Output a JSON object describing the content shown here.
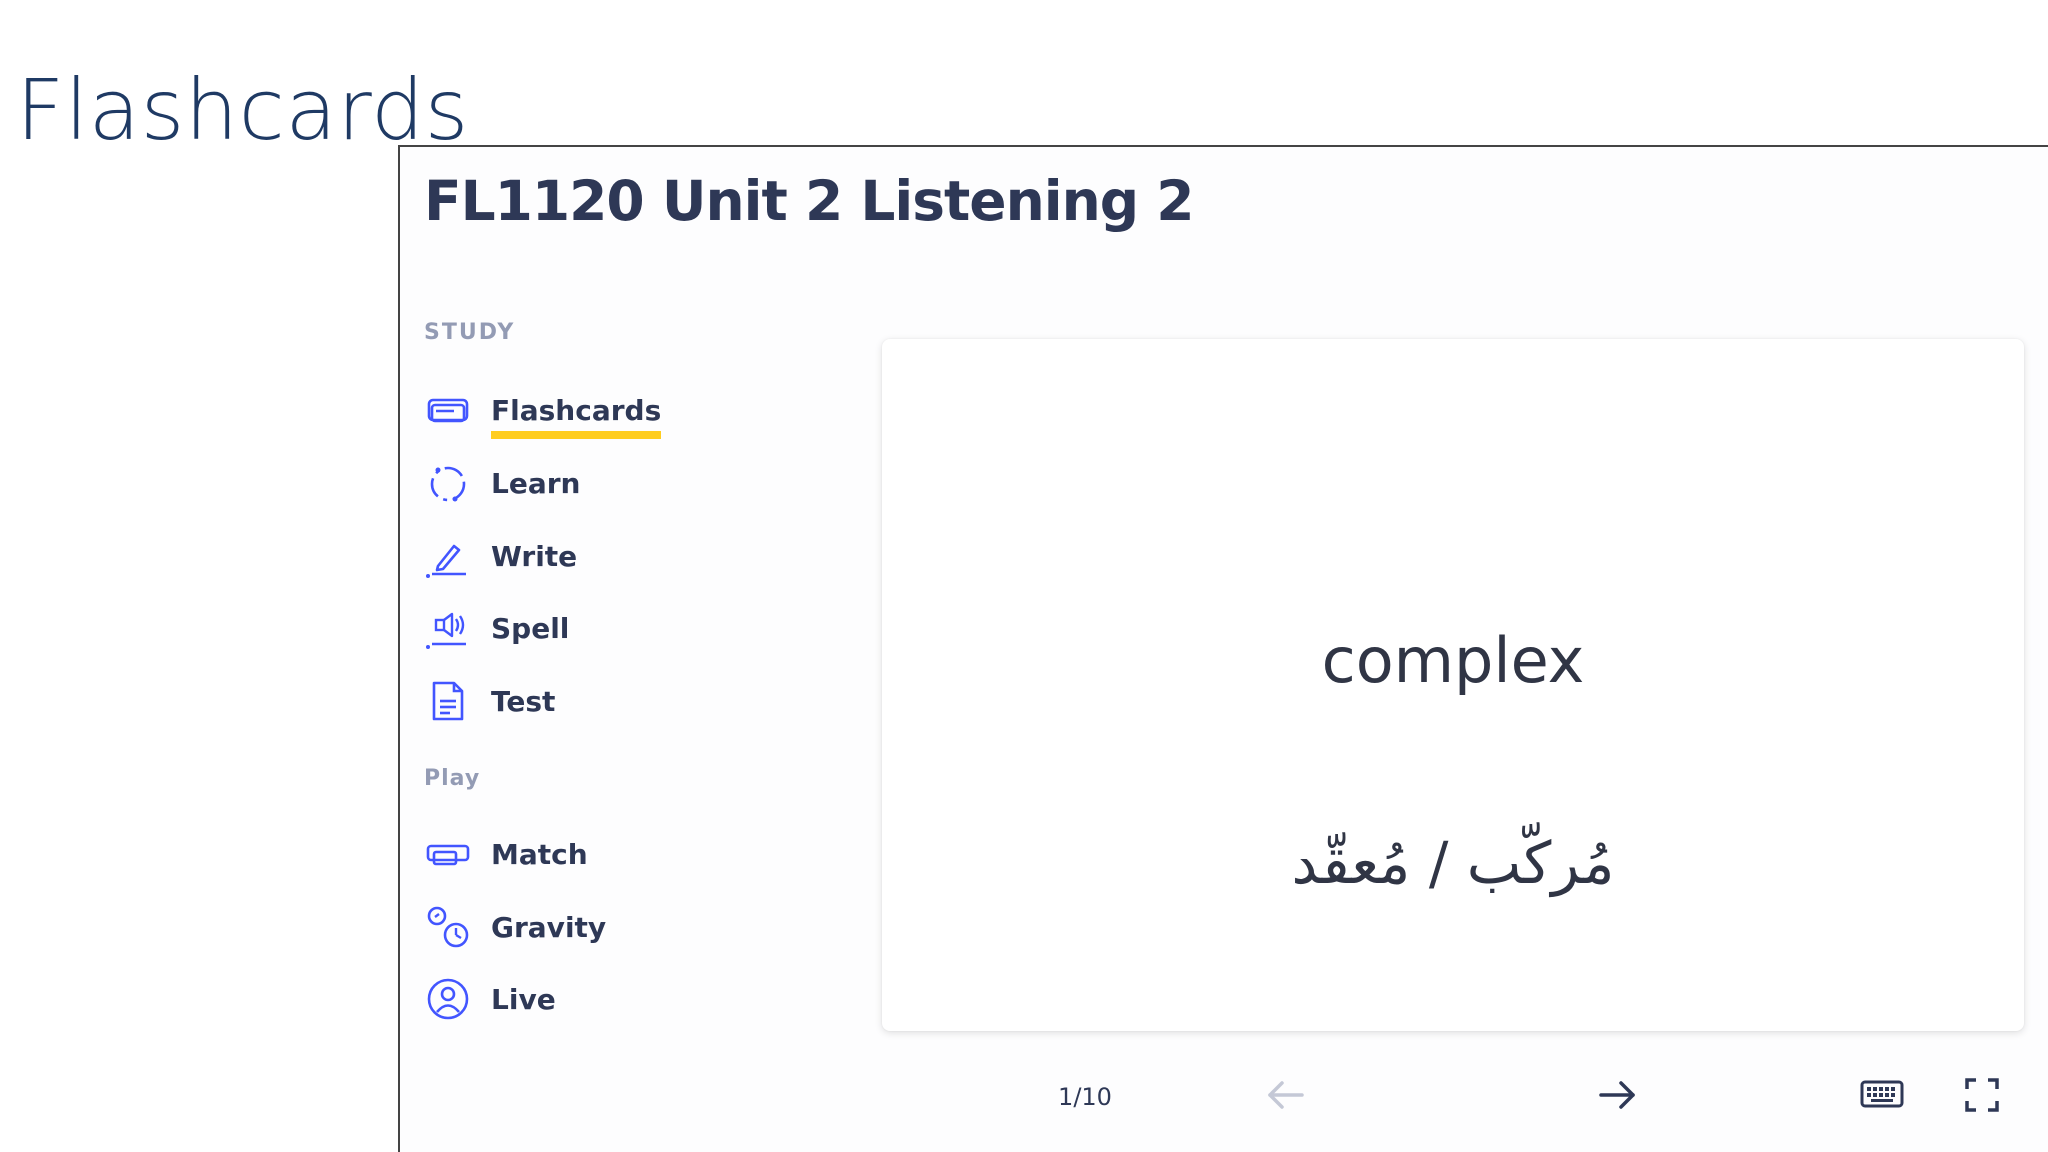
{
  "slide": {
    "title": "Flashcards"
  },
  "set": {
    "title": "FL1120 Unit 2 Listening 2"
  },
  "sidebar": {
    "study_label": "STUDY",
    "study_items": [
      {
        "label": "Flashcards",
        "icon": "flashcards-icon",
        "active": true
      },
      {
        "label": "Learn",
        "icon": "learn-icon"
      },
      {
        "label": "Write",
        "icon": "write-icon"
      },
      {
        "label": "Spell",
        "icon": "spell-icon"
      },
      {
        "label": "Test",
        "icon": "test-icon"
      }
    ],
    "play_label": "Play",
    "play_items": [
      {
        "label": "Match",
        "icon": "match-icon"
      },
      {
        "label": "Gravity",
        "icon": "gravity-icon"
      },
      {
        "label": "Live",
        "icon": "live-icon"
      }
    ]
  },
  "card": {
    "term": "complex",
    "definition": "مُركّب / مُعقّد"
  },
  "controls": {
    "counter": "1/10",
    "prev_icon": "arrow-left-icon",
    "next_icon": "arrow-right-icon",
    "keyboard_icon": "keyboard-icon",
    "fullscreen_icon": "fullscreen-icon"
  },
  "colors": {
    "title": "#1f3a64",
    "text": "#2e3856",
    "muted": "#939bb4",
    "accent_underline": "#ffcd1f",
    "icon": "#4255ff"
  }
}
